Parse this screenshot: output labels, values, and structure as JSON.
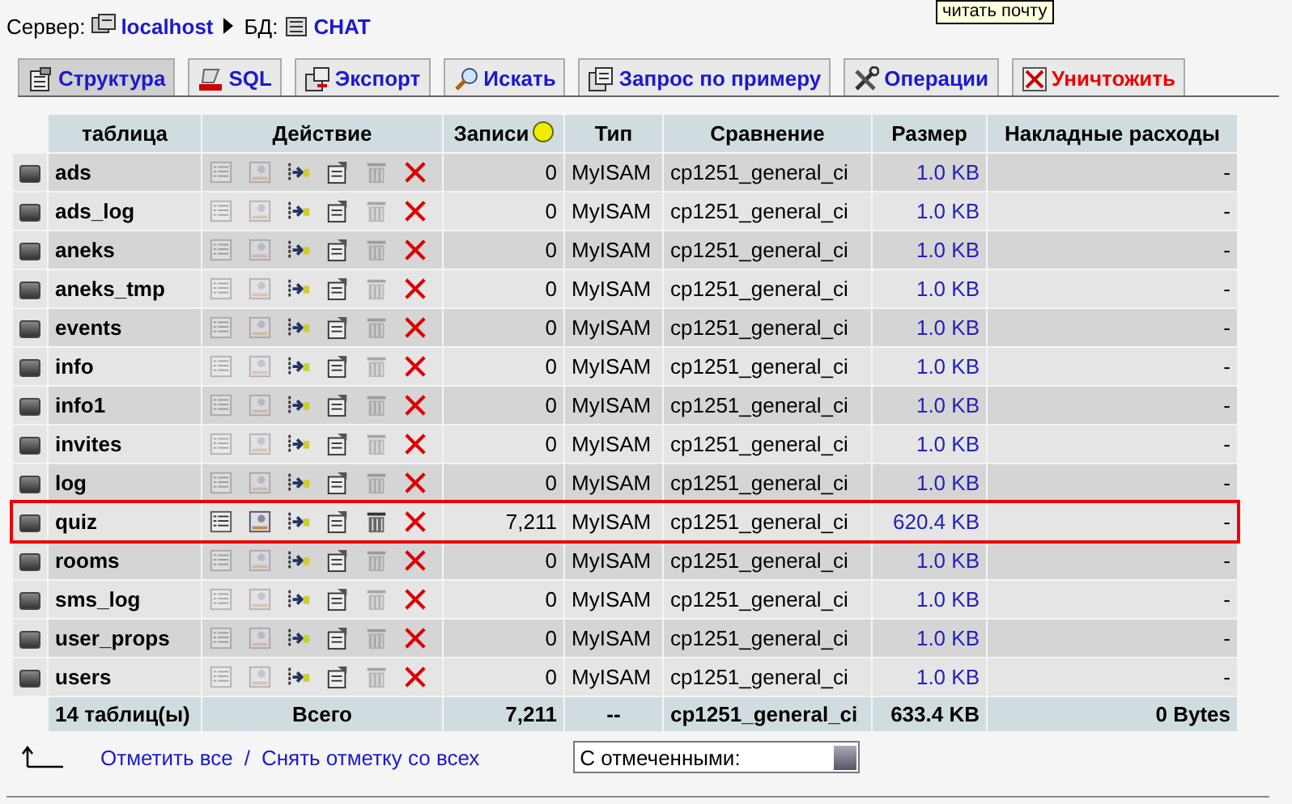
{
  "tooltip": "читать почту",
  "breadcrumb": {
    "server_label": "Сервер:",
    "server": "localhost",
    "db_label": "БД:",
    "db": "CHAT"
  },
  "tabs": [
    {
      "label": "Структура",
      "kind": "structure",
      "selected": true,
      "danger": false
    },
    {
      "label": "SQL",
      "kind": "sql",
      "selected": false,
      "danger": false
    },
    {
      "label": "Экспорт",
      "kind": "export",
      "selected": false,
      "danger": false
    },
    {
      "label": "Искать",
      "kind": "search",
      "selected": false,
      "danger": false
    },
    {
      "label": "Запрос по примеру",
      "kind": "query",
      "selected": false,
      "danger": false
    },
    {
      "label": "Операции",
      "kind": "operations",
      "selected": false,
      "danger": false
    },
    {
      "label": "Уничтожить",
      "kind": "drop",
      "selected": false,
      "danger": true
    }
  ],
  "table": {
    "columns": [
      "таблица",
      "Действие",
      "Записи",
      "Тип",
      "Сравнение",
      "Размер",
      "Накладные расходы"
    ],
    "rows": [
      {
        "name": "ads",
        "checked": false,
        "records": "0",
        "type": "MyISAM",
        "collation": "cp1251_general_ci",
        "size": "1.0 KB",
        "overhead": "-",
        "has_records": false,
        "highlighted": false
      },
      {
        "name": "ads_log",
        "checked": false,
        "records": "0",
        "type": "MyISAM",
        "collation": "cp1251_general_ci",
        "size": "1.0 KB",
        "overhead": "-",
        "has_records": false,
        "highlighted": false
      },
      {
        "name": "aneks",
        "checked": false,
        "records": "0",
        "type": "MyISAM",
        "collation": "cp1251_general_ci",
        "size": "1.0 KB",
        "overhead": "-",
        "has_records": false,
        "highlighted": false
      },
      {
        "name": "aneks_tmp",
        "checked": false,
        "records": "0",
        "type": "MyISAM",
        "collation": "cp1251_general_ci",
        "size": "1.0 KB",
        "overhead": "-",
        "has_records": false,
        "highlighted": false
      },
      {
        "name": "events",
        "checked": false,
        "records": "0",
        "type": "MyISAM",
        "collation": "cp1251_general_ci",
        "size": "1.0 KB",
        "overhead": "-",
        "has_records": false,
        "highlighted": false
      },
      {
        "name": "info",
        "checked": false,
        "records": "0",
        "type": "MyISAM",
        "collation": "cp1251_general_ci",
        "size": "1.0 KB",
        "overhead": "-",
        "has_records": false,
        "highlighted": false
      },
      {
        "name": "info1",
        "checked": false,
        "records": "0",
        "type": "MyISAM",
        "collation": "cp1251_general_ci",
        "size": "1.0 KB",
        "overhead": "-",
        "has_records": false,
        "highlighted": false
      },
      {
        "name": "invites",
        "checked": false,
        "records": "0",
        "type": "MyISAM",
        "collation": "cp1251_general_ci",
        "size": "1.0 KB",
        "overhead": "-",
        "has_records": false,
        "highlighted": false
      },
      {
        "name": "log",
        "checked": false,
        "records": "0",
        "type": "MyISAM",
        "collation": "cp1251_general_ci",
        "size": "1.0 KB",
        "overhead": "-",
        "has_records": false,
        "highlighted": false
      },
      {
        "name": "quiz",
        "checked": false,
        "records": "7,211",
        "type": "MyISAM",
        "collation": "cp1251_general_ci",
        "size": "620.4 KB",
        "overhead": "-",
        "has_records": true,
        "highlighted": true
      },
      {
        "name": "rooms",
        "checked": false,
        "records": "0",
        "type": "MyISAM",
        "collation": "cp1251_general_ci",
        "size": "1.0 KB",
        "overhead": "-",
        "has_records": false,
        "highlighted": false
      },
      {
        "name": "sms_log",
        "checked": false,
        "records": "0",
        "type": "MyISAM",
        "collation": "cp1251_general_ci",
        "size": "1.0 KB",
        "overhead": "-",
        "has_records": false,
        "highlighted": false
      },
      {
        "name": "user_props",
        "checked": false,
        "records": "0",
        "type": "MyISAM",
        "collation": "cp1251_general_ci",
        "size": "1.0 KB",
        "overhead": "-",
        "has_records": false,
        "highlighted": false
      },
      {
        "name": "users",
        "checked": false,
        "records": "0",
        "type": "MyISAM",
        "collation": "cp1251_general_ci",
        "size": "1.0 KB",
        "overhead": "-",
        "has_records": false,
        "highlighted": false
      }
    ],
    "footer": {
      "count": "14 таблиц(ы)",
      "label": "Всего",
      "records": "7,211",
      "type": "--",
      "collation": "cp1251_general_ci",
      "size": "633.4 KB",
      "overhead": "0 Bytes"
    }
  },
  "bottom": {
    "check_all": "Отметить все",
    "separator": "/",
    "uncheck_all": "Снять отметку со всех",
    "with_selected": "С отмеченными:"
  }
}
